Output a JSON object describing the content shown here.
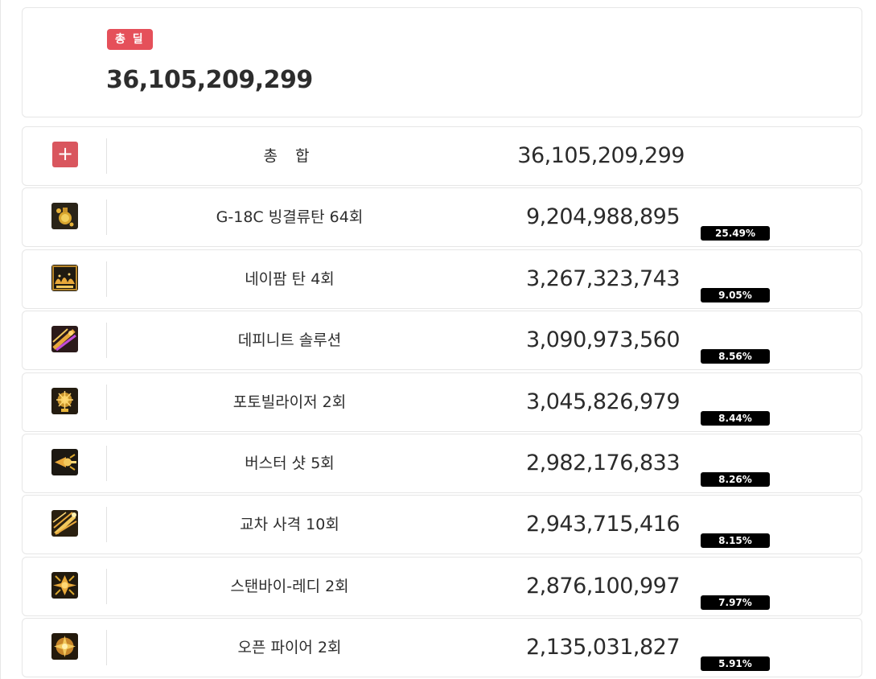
{
  "summary": {
    "badge": "총 딜",
    "value": "36,105,209,299"
  },
  "total_row": {
    "name": "총 합",
    "value": "36,105,209,299",
    "icon": "plus-icon"
  },
  "rows": [
    {
      "name": "G-18C 빙결류탄 64회",
      "value": "9,204,988,895",
      "percent": "25.49%",
      "percent_value": 25.49,
      "icon": "frost-grenade-icon"
    },
    {
      "name": "네이팜 탄 4회",
      "value": "3,267,323,743",
      "percent": "9.05%",
      "percent_value": 9.05,
      "icon": "napalm-icon"
    },
    {
      "name": "데피니트 솔루션",
      "value": "3,090,973,560",
      "percent": "8.56%",
      "percent_value": 8.56,
      "icon": "definite-solution-icon"
    },
    {
      "name": "포토빌라이저 2회",
      "value": "3,045,826,979",
      "percent": "8.44%",
      "percent_value": 8.44,
      "icon": "photobilizer-icon"
    },
    {
      "name": "버스터 샷 5회",
      "value": "2,982,176,833",
      "percent": "8.26%",
      "percent_value": 8.26,
      "icon": "buster-shot-icon"
    },
    {
      "name": "교차 사격 10회",
      "value": "2,943,715,416",
      "percent": "8.15%",
      "percent_value": 8.15,
      "icon": "cross-fire-icon"
    },
    {
      "name": "스탠바이-레디 2회",
      "value": "2,876,100,997",
      "percent": "7.97%",
      "percent_value": 7.97,
      "icon": "standby-ready-icon"
    },
    {
      "name": "오픈 파이어 2회",
      "value": "2,135,031,827",
      "percent": "5.91%",
      "percent_value": 5.91,
      "icon": "open-fire-icon"
    }
  ],
  "colors": {
    "summary_badge": "#e5505a",
    "plus_box": "#d9565e",
    "percent_badge": "#000000",
    "icon_gold": "#e8b43a"
  }
}
